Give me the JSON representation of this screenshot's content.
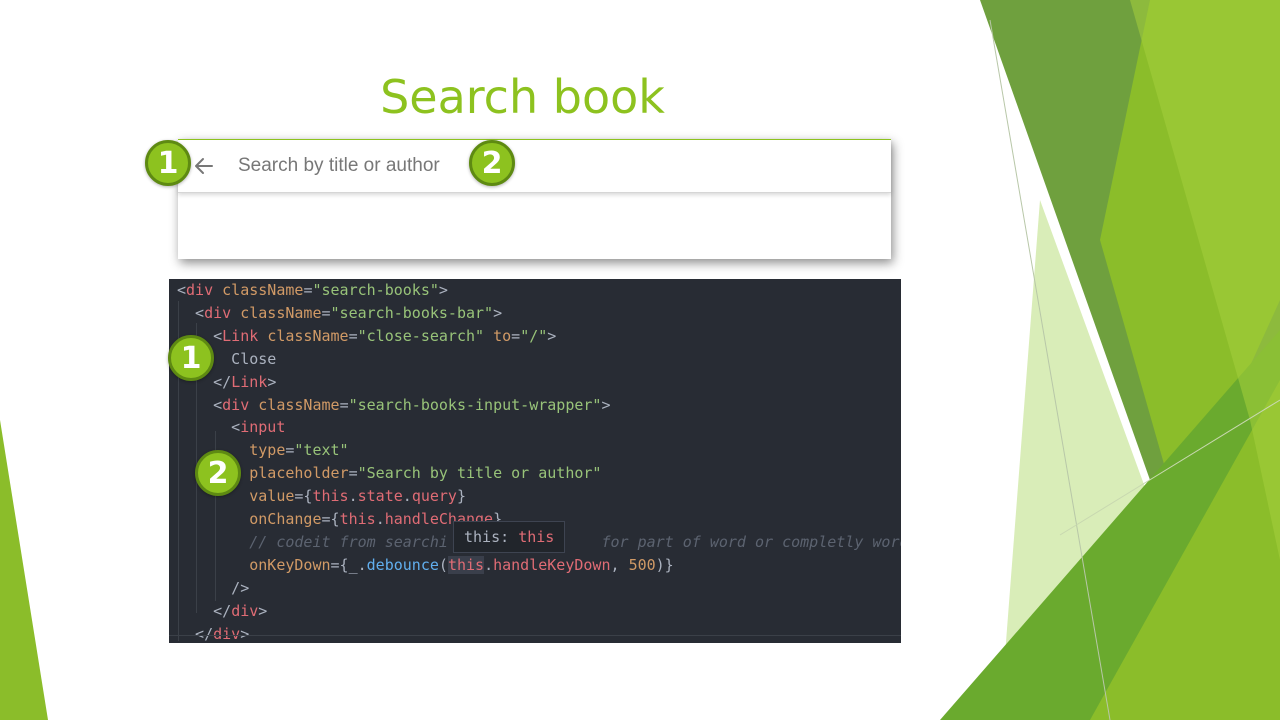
{
  "slide": {
    "title": "Search book"
  },
  "search": {
    "placeholder": "Search by title or author"
  },
  "badges": {
    "one": "1",
    "two": "2"
  },
  "tooltip": {
    "label": "this:",
    "value": "this"
  },
  "code_lines": [
    [
      [
        "c-p",
        "<"
      ],
      [
        "c-t",
        "div"
      ],
      [
        "c-p",
        " "
      ],
      [
        "c-a",
        "className"
      ],
      [
        "c-p",
        "="
      ],
      [
        "c-s",
        "\"search-books\""
      ],
      [
        "c-p",
        ">"
      ]
    ],
    [
      [
        "c-p",
        "  <"
      ],
      [
        "c-t",
        "div"
      ],
      [
        "c-p",
        " "
      ],
      [
        "c-a",
        "className"
      ],
      [
        "c-p",
        "="
      ],
      [
        "c-s",
        "\"search-books-bar\""
      ],
      [
        "c-p",
        ">"
      ]
    ],
    [
      [
        "c-p",
        "    <"
      ],
      [
        "c-t",
        "Link"
      ],
      [
        "c-p",
        " "
      ],
      [
        "c-a",
        "className"
      ],
      [
        "c-p",
        "="
      ],
      [
        "c-s",
        "\"close-search\""
      ],
      [
        "c-p",
        " "
      ],
      [
        "c-a",
        "to"
      ],
      [
        "c-p",
        "="
      ],
      [
        "c-s",
        "\"/\""
      ],
      [
        "c-p",
        ">"
      ]
    ],
    [
      [
        "c-p",
        "      Close"
      ]
    ],
    [
      [
        "c-p",
        "    </"
      ],
      [
        "c-t",
        "Link"
      ],
      [
        "c-p",
        ">"
      ]
    ],
    [
      [
        "c-p",
        "    <"
      ],
      [
        "c-t",
        "div"
      ],
      [
        "c-p",
        " "
      ],
      [
        "c-a",
        "className"
      ],
      [
        "c-p",
        "="
      ],
      [
        "c-s",
        "\"search-books-input-wrapper\""
      ],
      [
        "c-p",
        ">"
      ]
    ],
    [
      [
        "c-p",
        "      <"
      ],
      [
        "c-t",
        "input"
      ]
    ],
    [
      [
        "c-p",
        "        "
      ],
      [
        "c-a",
        "type"
      ],
      [
        "c-p",
        "="
      ],
      [
        "c-s",
        "\"text\""
      ]
    ],
    [
      [
        "c-p",
        "        "
      ],
      [
        "c-a",
        "placeholder"
      ],
      [
        "c-p",
        "="
      ],
      [
        "c-s",
        "\"Search by title or author\""
      ]
    ],
    [
      [
        "c-p",
        "        "
      ],
      [
        "c-a",
        "value"
      ],
      [
        "c-p",
        "={"
      ],
      [
        "c-k",
        "this"
      ],
      [
        "c-p",
        "."
      ],
      [
        "c-t",
        "state"
      ],
      [
        "c-p",
        "."
      ],
      [
        "c-t",
        "query"
      ],
      [
        "c-p",
        "}"
      ]
    ],
    [
      [
        "c-p",
        "        "
      ],
      [
        "c-a",
        "onChange"
      ],
      [
        "c-p",
        "={"
      ],
      [
        "c-k",
        "this"
      ],
      [
        "c-p",
        "."
      ],
      [
        "c-t",
        "handleChange"
      ],
      [
        "c-p",
        "}"
      ]
    ],
    [
      [
        "c-p",
        "        "
      ],
      [
        "c-c",
        "// codeit from searchi"
      ],
      [
        "c-c",
        "                 for part of word or completly word"
      ]
    ],
    [
      [
        "c-p",
        "        "
      ],
      [
        "c-a",
        "onKeyDown"
      ],
      [
        "c-p",
        "={_."
      ],
      [
        "c-f",
        "debounce"
      ],
      [
        "c-p",
        "("
      ],
      [
        "c-k hl",
        "this"
      ],
      [
        "c-p",
        "."
      ],
      [
        "c-t",
        "handleKeyDown"
      ],
      [
        "c-p",
        ", "
      ],
      [
        "c-n",
        "500"
      ],
      [
        "c-p",
        ")}"
      ]
    ],
    [
      [
        "c-p",
        "      />"
      ]
    ],
    [
      [
        "c-p",
        "    </"
      ],
      [
        "c-t",
        "div"
      ],
      [
        "c-p",
        ">"
      ]
    ],
    [
      [
        "c-p",
        "  </"
      ],
      [
        "c-t",
        "div"
      ],
      [
        "c-p",
        ">"
      ]
    ]
  ],
  "colors": {
    "accent_green": "#8dc21f",
    "code_bg": "#282c34"
  }
}
